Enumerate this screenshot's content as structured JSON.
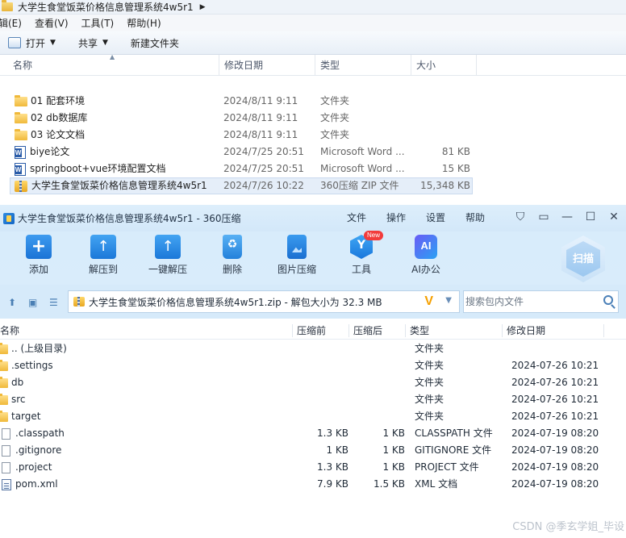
{
  "explorer": {
    "title": "大学生食堂饭菜价格信息管理系统4w5r1",
    "menu": [
      "辑(E)",
      "查看(V)",
      "工具(T)",
      "帮助(H)"
    ],
    "toolbar": {
      "open": "打开",
      "share": "共享",
      "new_folder": "新建文件夹"
    },
    "columns": {
      "name": "名称",
      "date": "修改日期",
      "type": "类型",
      "size": "大小"
    },
    "rows": [
      {
        "name": "01 配套环境",
        "date": "2024/8/11 9:11",
        "type": "文件夹",
        "size": "",
        "icon": "folder-icon"
      },
      {
        "name": "02 db数据库",
        "date": "2024/8/11 9:11",
        "type": "文件夹",
        "size": "",
        "icon": "folder-icon"
      },
      {
        "name": "03 论文文档",
        "date": "2024/8/11 9:11",
        "type": "文件夹",
        "size": "",
        "icon": "folder-icon"
      },
      {
        "name": "biye论文",
        "date": "2024/7/25 20:51",
        "type": "Microsoft Word ...",
        "size": "81 KB",
        "icon": "word-icon"
      },
      {
        "name": "springboot+vue环境配置文档",
        "date": "2024/7/25 20:51",
        "type": "Microsoft Word ...",
        "size": "15 KB",
        "icon": "word-icon"
      },
      {
        "name": "大学生食堂饭菜价格信息管理系统4w5r1",
        "date": "2024/7/26 10:22",
        "type": "360压缩 ZIP 文件",
        "size": "15,348 KB",
        "icon": "zip-icon"
      }
    ]
  },
  "zip": {
    "title": "大学生食堂饭菜价格信息管理系统4w5r1 - 360压缩",
    "menus": [
      "文件",
      "操作",
      "设置",
      "帮助"
    ],
    "toolbar": {
      "add": "添加",
      "extract_to": "解压到",
      "one_click": "一键解压",
      "delete": "删除",
      "image_compress": "图片压缩",
      "tools": "工具",
      "ai_office": "AI办公",
      "new_badge": "New",
      "scan": "扫描"
    },
    "address": "大学生食堂饭菜价格信息管理系统4w5r1.zip - 解包大小为 32.3 MB",
    "search_placeholder": "搜索包内文件",
    "columns": {
      "name": "名称",
      "compressed_before": "压缩前",
      "compressed_after": "压缩后",
      "type": "类型",
      "date": "修改日期"
    },
    "rows": [
      {
        "name": ".. (上级目录)",
        "before": "",
        "after": "",
        "type": "文件夹",
        "date": "",
        "icon": "folder-icon"
      },
      {
        "name": ".settings",
        "before": "",
        "after": "",
        "type": "文件夹",
        "date": "2024-07-26 10:21",
        "icon": "folder-icon"
      },
      {
        "name": "db",
        "before": "",
        "after": "",
        "type": "文件夹",
        "date": "2024-07-26 10:21",
        "icon": "folder-icon"
      },
      {
        "name": "src",
        "before": "",
        "after": "",
        "type": "文件夹",
        "date": "2024-07-26 10:21",
        "icon": "folder-icon"
      },
      {
        "name": "target",
        "before": "",
        "after": "",
        "type": "文件夹",
        "date": "2024-07-26 10:21",
        "icon": "folder-icon"
      },
      {
        "name": ".classpath",
        "before": "1.3 KB",
        "after": "1 KB",
        "type": "CLASSPATH 文件",
        "date": "2024-07-19 08:20",
        "icon": "file-icon"
      },
      {
        "name": ".gitignore",
        "before": "1 KB",
        "after": "1 KB",
        "type": "GITIGNORE 文件",
        "date": "2024-07-19 08:20",
        "icon": "file-icon"
      },
      {
        "name": ".project",
        "before": "1.3 KB",
        "after": "1 KB",
        "type": "PROJECT 文件",
        "date": "2024-07-19 08:20",
        "icon": "file-icon"
      },
      {
        "name": "pom.xml",
        "before": "7.9 KB",
        "after": "1.5 KB",
        "type": "XML 文档",
        "date": "2024-07-19 08:20",
        "icon": "xml-icon"
      }
    ]
  },
  "watermark": "CSDN @季玄学姐_毕设"
}
